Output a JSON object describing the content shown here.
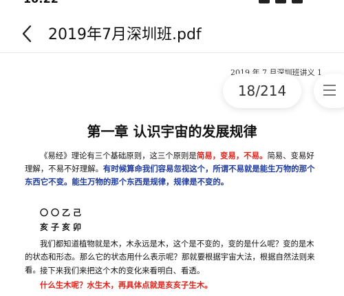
{
  "status_bar": {
    "time": "10:22"
  },
  "header": {
    "title": "2019年7月深圳班.pdf"
  },
  "page_indicator": {
    "text": "18/214"
  },
  "document": {
    "running_header": "2019 年 7 月深圳班讲义  1",
    "chapter_title": "第一章  认识宇宙的发展规律",
    "para1": {
      "s1": "《易经》理论有三个基础原则，这三个原则是",
      "s2": "简易，变易，不易。",
      "s3": "简易、变易好理解，不易不好理解。",
      "s4": "有时候算命我们容易忽视这个，所谓不易就是能生万物的那个东西它不变。能生万物的那个东西是规律，规律是不变的。"
    },
    "stems": "〇〇乙己",
    "branches": "亥子亥卯",
    "para2": "我们都知道植物就是木，木永远是木，这个是不变的，变的是什么呢？变的是木的状态和形态。那么它的状态用什么表示呢？那就要根据宇宙大法，根据自然法则来看。",
    "para3": "接下来我们来把这个木的变化来看明白、看透。",
    "para4": "什么生木呢？水生木，再具体点就是亥亥子生木。"
  },
  "colors": {
    "highlight_red": "#e2231a",
    "highlight_blue": "#1e3a9c"
  },
  "icons": {
    "back": "chevron-left-icon",
    "menu": "menu-lines-icon"
  }
}
